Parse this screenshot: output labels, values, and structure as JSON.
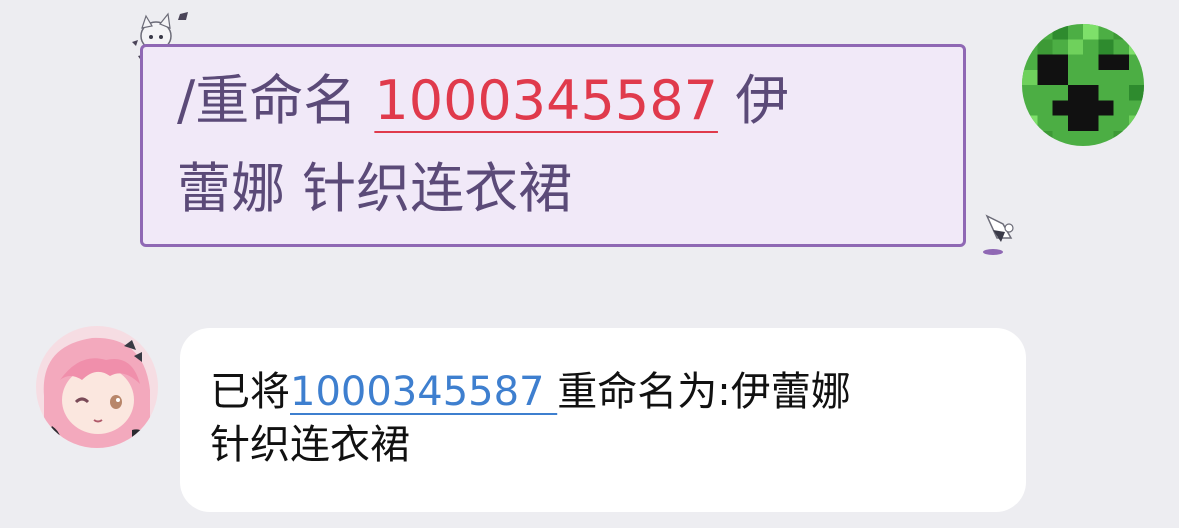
{
  "outgoing": {
    "command_prefix": "/重命名 ",
    "item_id": "1000345587",
    "new_name_part1": " 伊",
    "new_name_part2": "蕾娜 针织连衣裙",
    "avatar_icon": "creeper-icon",
    "colors": {
      "bubble_bg": "#f1e9f8",
      "bubble_border": "#8f68b4",
      "text": "#5b4a78",
      "id": "#e03a4c"
    }
  },
  "incoming": {
    "prefix": "已将",
    "item_id": "1000345587 ",
    "middle": "重命名为:伊蕾娜",
    "line2": "针织连衣裙",
    "avatar_icon": "anime-girl-avatar-icon",
    "colors": {
      "bubble_bg": "#ffffff",
      "text": "#111111",
      "id": "#3e7fcf"
    }
  }
}
